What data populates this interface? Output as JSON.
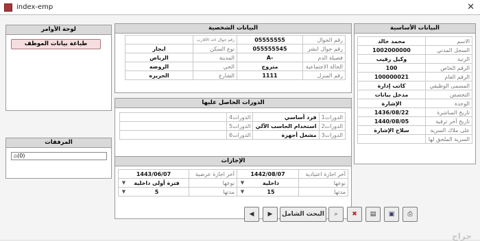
{
  "window": {
    "title": "index-emp"
  },
  "commands": {
    "title": "لوحة الأوامر",
    "print_button": "طباعة بيانات الموظف"
  },
  "attachments": {
    "title": "المرفقات",
    "field_value": "(0)"
  },
  "basic": {
    "title": "البيانات الأساسية",
    "rows": [
      {
        "label": "الاسم",
        "value": "محمد خالد"
      },
      {
        "label": "السجل المدني",
        "value": "1002000000"
      },
      {
        "label": "الرتبة",
        "value": "وكيل رقيب"
      },
      {
        "label": "الرقم الخاص",
        "value": "100"
      },
      {
        "label": "الرقم العام",
        "value": "100000021"
      },
      {
        "label": "المسمى الوظيفي",
        "value": "كاتب إدارة"
      },
      {
        "label": "التخصص",
        "value": "مدخل بيانات"
      },
      {
        "label": "الوحدة",
        "value": "الإشارة"
      },
      {
        "label": "تاريخ المباشرة",
        "value": "1436/08/22"
      },
      {
        "label": "تاريخ آخر ترقية",
        "value": "1440/08/05"
      },
      {
        "label": "على ملاك السرية",
        "value": "سلاح الإشارة"
      },
      {
        "label": "السرية الملحق لها",
        "value": ""
      }
    ]
  },
  "personal": {
    "title": "البيانات الشخصية",
    "rows": [
      {
        "l1": "رقم الجوال",
        "v1": "05555555",
        "l2": "رقم جوال احد الأقارب",
        "v2": ""
      },
      {
        "l1": "رقم جوال ابشر",
        "v1": "055555545",
        "l2": "نوع السكن",
        "v2": "ايجار"
      },
      {
        "l1": "فصيلة الدم",
        "v1": "-A",
        "l2": "المدينة",
        "v2": "الرياض"
      },
      {
        "l1": "الحالة الاجتماعية",
        "v1": "متزوج",
        "l2": "الحي",
        "v2": "الروضه"
      },
      {
        "l1": "رقم المنزل",
        "v1": "1111",
        "l2": "الشارع",
        "v2": "الجزيره"
      }
    ]
  },
  "courses": {
    "title": "الدورات الحاصل عليها",
    "rows": [
      {
        "l1": "الدورات1",
        "v1": "فرد أساسي",
        "l2": "الدورات4",
        "v2": ""
      },
      {
        "l1": "الدورات2",
        "v1": "استخدام الحاسب الآلي",
        "l2": "الدورات5",
        "v2": ""
      },
      {
        "l1": "الدورات3",
        "v1": "مشغل أجهزة",
        "l2": "الدورات6",
        "v2": ""
      }
    ]
  },
  "leaves": {
    "title": "الإجازات",
    "cols": [
      {
        "h_label": "آخر اجازة اعتيادية",
        "h_value": "1442/08/07",
        "t_label": "نوعها",
        "t_value": "داخلية",
        "d_label": "مدتها",
        "d_value": "15"
      },
      {
        "h_label": "آخر اجازة عرضية",
        "h_value": "1443/06/07",
        "t_label": "نوعها",
        "t_value": "فترة أولى داخلية",
        "d_label": "مدتها",
        "d_value": "5"
      }
    ]
  },
  "navigation": {
    "search_label": "البحث الشامل",
    "prev_arrow": "◀",
    "next_arrow": "▶"
  },
  "watermark": "حراج"
}
